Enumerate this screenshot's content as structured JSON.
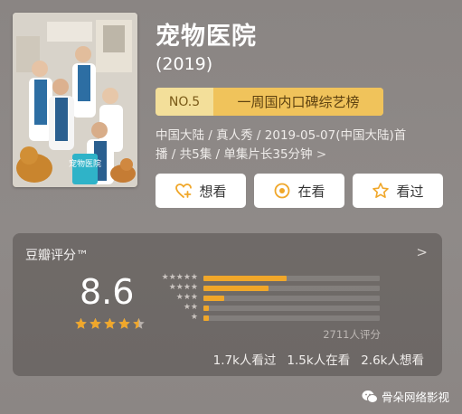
{
  "poster": {
    "text": "宠物医院"
  },
  "title": "宠物医院",
  "year": "(2019)",
  "rank": {
    "number": "NO.5",
    "label": "一周国内口碑综艺榜"
  },
  "meta": {
    "line1": "中国大陆 / 真人秀 / 2019-05-07(中国大陆)首",
    "line2": "播 / 共5集 / 单集片长35分钟",
    "chevron": ">"
  },
  "actions": {
    "wish": "想看",
    "doing": "在看",
    "done": "看过"
  },
  "rating": {
    "title": "豆瓣评分™",
    "chevron": ">",
    "score": "8.6",
    "star_value": 4.5,
    "distribution": [
      {
        "stars": 5,
        "percent": 47
      },
      {
        "stars": 4,
        "percent": 37
      },
      {
        "stars": 3,
        "percent": 12
      },
      {
        "stars": 2,
        "percent": 3
      },
      {
        "stars": 1,
        "percent": 3
      }
    ],
    "count_text": "2711人评分",
    "stats": {
      "watched": "1.7k人看过",
      "watching": "1.5k人在看",
      "want": "2.6k人想看"
    }
  },
  "watermark": "骨朵网络影视",
  "colors": {
    "accent": "#f0a72a",
    "rank_bg": "#f0c35b",
    "button_bg": "#ffffff",
    "icon": "#f0a72a"
  }
}
